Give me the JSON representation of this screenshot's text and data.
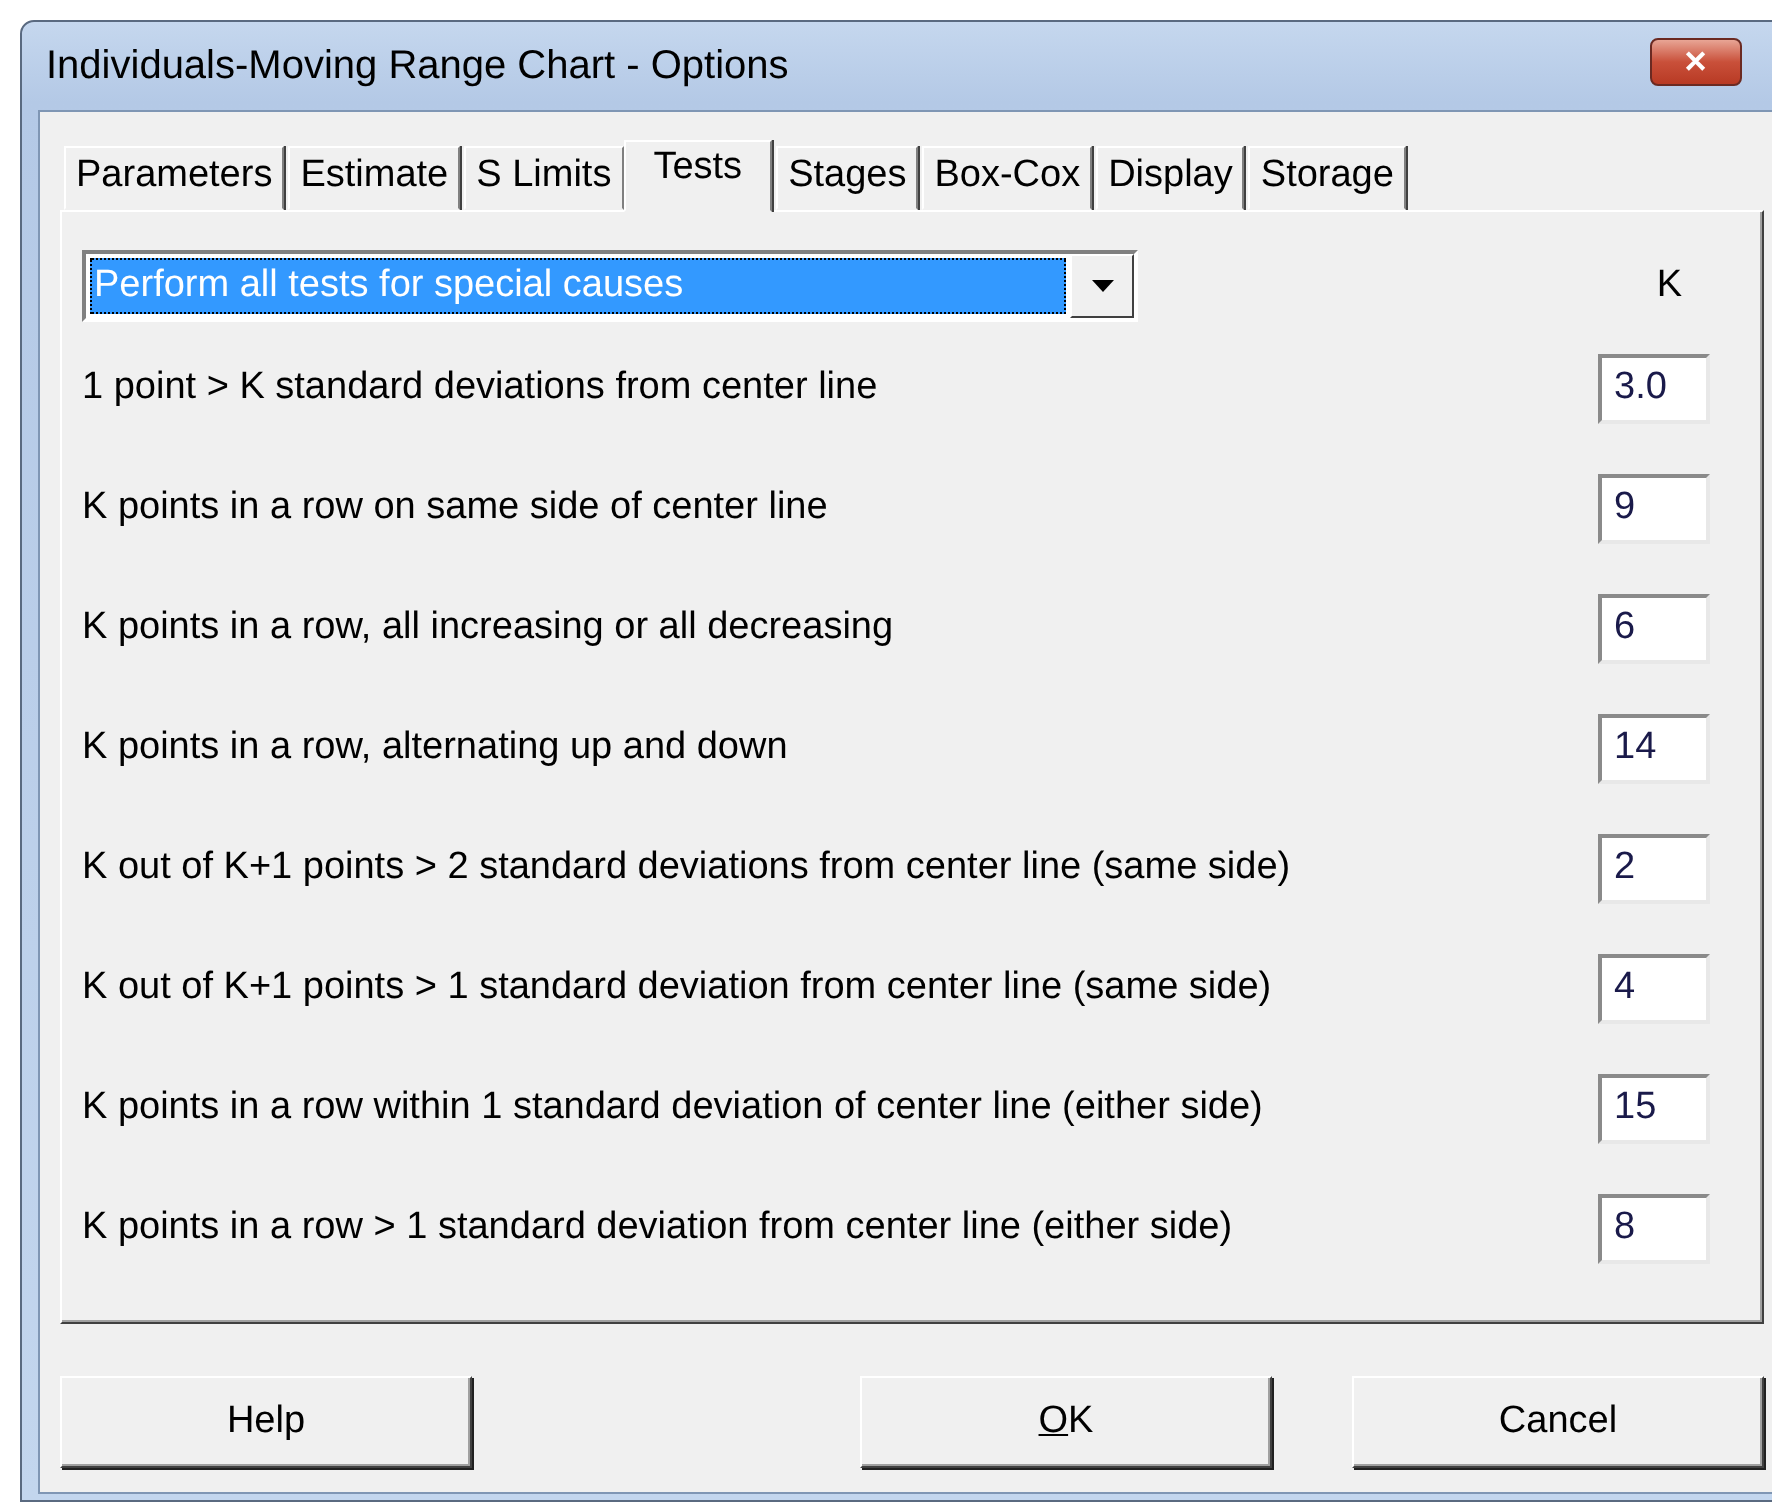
{
  "window": {
    "title": "Individuals-Moving Range Chart - Options",
    "close": "✕"
  },
  "tabs": [
    {
      "label": "Parameters",
      "selected": false
    },
    {
      "label": "Estimate",
      "selected": false
    },
    {
      "label": "S Limits",
      "selected": false
    },
    {
      "label": "Tests",
      "selected": true
    },
    {
      "label": "Stages",
      "selected": false
    },
    {
      "label": "Box-Cox",
      "selected": false
    },
    {
      "label": "Display",
      "selected": false
    },
    {
      "label": "Storage",
      "selected": false
    }
  ],
  "test_mode": {
    "value": "Perform all tests for special causes",
    "focused": true
  },
  "k_heading": "K",
  "tests": [
    {
      "label": "1 point > K standard deviations from center line",
      "k": "3.0"
    },
    {
      "label": "K points in a row on same side of center line",
      "k": "9"
    },
    {
      "label": "K points in a row, all increasing or all decreasing",
      "k": "6"
    },
    {
      "label": "K points in a row, alternating up and down",
      "k": "14"
    },
    {
      "label": "K out of K+1 points > 2 standard deviations from center line (same side)",
      "k": "2"
    },
    {
      "label": "K out of K+1 points > 1 standard deviation from center line (same side)",
      "k": "4"
    },
    {
      "label": "K points in a row within 1 standard deviation of center line (either side)",
      "k": "15"
    },
    {
      "label": "K points in a row > 1 standard deviation from center line (either side)",
      "k": "8"
    }
  ],
  "buttons": [
    {
      "label": "Help",
      "underline_first": false
    },
    {
      "label": "OK",
      "underline_first": true
    },
    {
      "label": "Cancel",
      "underline_first": false
    }
  ]
}
